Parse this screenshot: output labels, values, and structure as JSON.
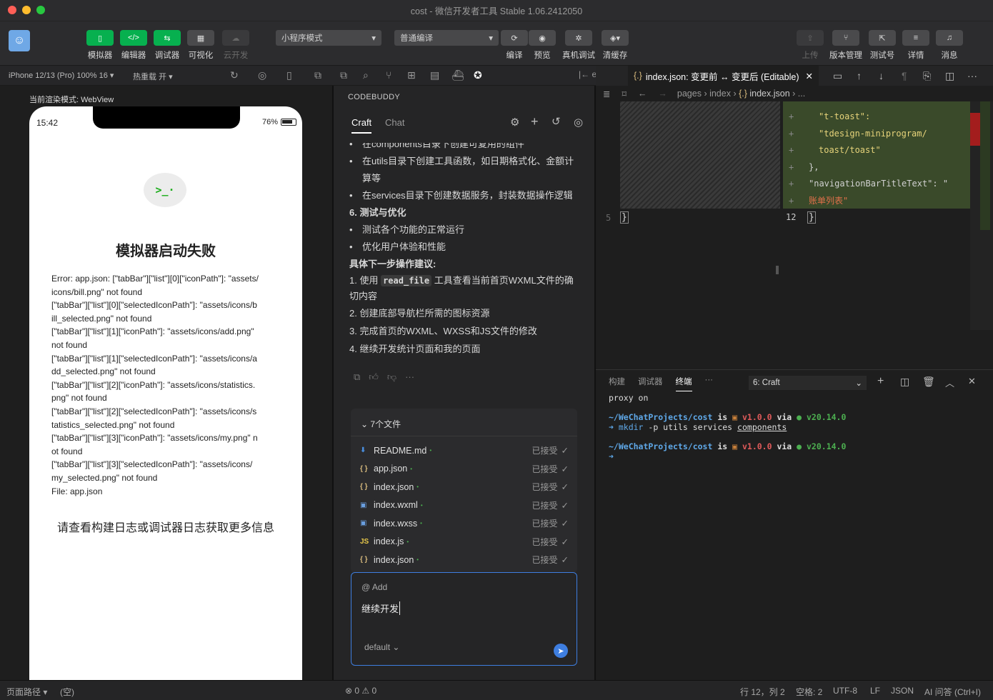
{
  "window": {
    "title": "cost - 微信开发者工具 Stable 1.06.2412050"
  },
  "toolbar": {
    "simulator": "模拟器",
    "editor": "编辑器",
    "debugger": "调试器",
    "visual": "可视化",
    "cloud": "云开发",
    "mode": "小程序模式",
    "compile_mode": "普通编译",
    "compile": "编译",
    "preview": "预览",
    "real_debug": "真机调试",
    "clear_cache": "清缓存",
    "upload": "上传",
    "version": "版本管理",
    "test": "测试号",
    "details": "详情",
    "messages": "消息"
  },
  "subbar": {
    "device": "iPhone 12/13 (Pro) 100% 16 ▾",
    "hot_reload": "热重载 开 ▾"
  },
  "simulator": {
    "render_mode": "当前渲染模式: WebView",
    "time": "15:42",
    "battery": "76%",
    "error_title": "模拟器启动失败",
    "error_lines": [
      "Error: app.json: [\"tabBar\"][\"list\"][0][\"iconPath\"]: \"assets/",
      "icons/bill.png\" not found",
      "[\"tabBar\"][\"list\"][0][\"selectedIconPath\"]: \"assets/icons/b",
      "ill_selected.png\" not found",
      "[\"tabBar\"][\"list\"][1][\"iconPath\"]: \"assets/icons/add.png\"",
      "not found",
      "[\"tabBar\"][\"list\"][1][\"selectedIconPath\"]: \"assets/icons/a",
      "dd_selected.png\" not found",
      "[\"tabBar\"][\"list\"][2][\"iconPath\"]: \"assets/icons/statistics.",
      "png\" not found",
      "[\"tabBar\"][\"list\"][2][\"selectedIconPath\"]: \"assets/icons/s",
      "tatistics_selected.png\" not found",
      "[\"tabBar\"][\"list\"][3][\"iconPath\"]: \"assets/icons/my.png\" n",
      "ot found",
      "[\"tabBar\"][\"list\"][3][\"selectedIconPath\"]: \"assets/icons/",
      "my_selected.png\" not found",
      "File: app.json"
    ],
    "footer_hint": "请查看构建日志或调试器日志获取更多信息"
  },
  "codebuddy": {
    "header": "CODEBUDDY",
    "tabs": [
      "Craft",
      "Chat"
    ],
    "bullets": [
      {
        "type": "bullet",
        "text": "在components目录下创建可复用的组件"
      },
      {
        "type": "bullet",
        "text": "在utils目录下创建工具函数，如日期格式化、金额计算等"
      },
      {
        "type": "bullet",
        "text": "在services目录下创建数据服务，封装数据操作逻辑"
      },
      {
        "type": "heading",
        "text": "6. 测试与优化"
      },
      {
        "type": "bullet",
        "text": "测试各个功能的正常运行"
      },
      {
        "type": "bullet",
        "text": "优化用户体验和性能"
      },
      {
        "type": "heading",
        "text": "具体下一步操作建议:"
      }
    ],
    "step1_pre": "1. 使用 ",
    "step1_code": "read_file",
    "step1_post": " 工具查看当前首页WXML文件的确切内容",
    "steps": [
      "2. 创建底部导航栏所需的图标资源",
      "3. 完成首页的WXML、WXSS和JS文件的修改",
      "4. 继续开发统计页面和我的页面"
    ],
    "files_header": "7个文件",
    "files": [
      {
        "icon": "⬇",
        "name": "README.md",
        "status": "已接受",
        "color": "#4a8fe0"
      },
      {
        "icon": "{ }",
        "name": "app.json",
        "status": "已接受",
        "color": "#d7ba7d"
      },
      {
        "icon": "{ }",
        "name": "index.json",
        "status": "已接受",
        "color": "#d7ba7d"
      },
      {
        "icon": "▣",
        "name": "index.wxml",
        "status": "已接受",
        "color": "#6a9fe0"
      },
      {
        "icon": "▣",
        "name": "index.wxss",
        "status": "已接受",
        "color": "#6a9fe0"
      },
      {
        "icon": "JS",
        "name": "index.js",
        "status": "已接受",
        "color": "#e8c94a"
      },
      {
        "icon": "{ }",
        "name": "index.json",
        "status": "已接受",
        "color": "#d7ba7d"
      }
    ],
    "input": {
      "add": "@ Add",
      "value": "继续开发",
      "model": "default"
    }
  },
  "editor": {
    "tab": "index.json: 变更前 ↔ 变更后 (Editable)",
    "breadcrumb": [
      "pages",
      "index",
      "index.json",
      "..."
    ],
    "left_line_no": "5",
    "right_line_no": "12",
    "diff_lines": [
      "\"t-toast\":",
      "\"tdesign-miniprogram/",
      "toast/toast\"",
      "},",
      "\"navigationBarTitleText\": \"",
      "账单列表\""
    ]
  },
  "terminal": {
    "tabs": [
      "构建",
      "调试器",
      "终端",
      "···"
    ],
    "session": "6: Craft",
    "l1": "proxy on",
    "path": "~/WeChatProjects/cost",
    "is": " is ",
    "ver": " v1.0.0",
    "via": " via ",
    "node": " v20.14.0",
    "cmd_arrow": "➜ ",
    "cmd": "mkdir",
    "cmd_args": " -p utils services ",
    "cmd_last": "components"
  },
  "status": {
    "page_path": "页面路径 ▾",
    "empty": "(空)",
    "errors": "⊗ 0 ⚠ 0",
    "position": "行 12，列 2",
    "spaces": "空格: 2",
    "encoding": "UTF-8",
    "eol": "LF",
    "lang": "JSON",
    "ai": "AI 问答 (Ctrl+I)"
  }
}
